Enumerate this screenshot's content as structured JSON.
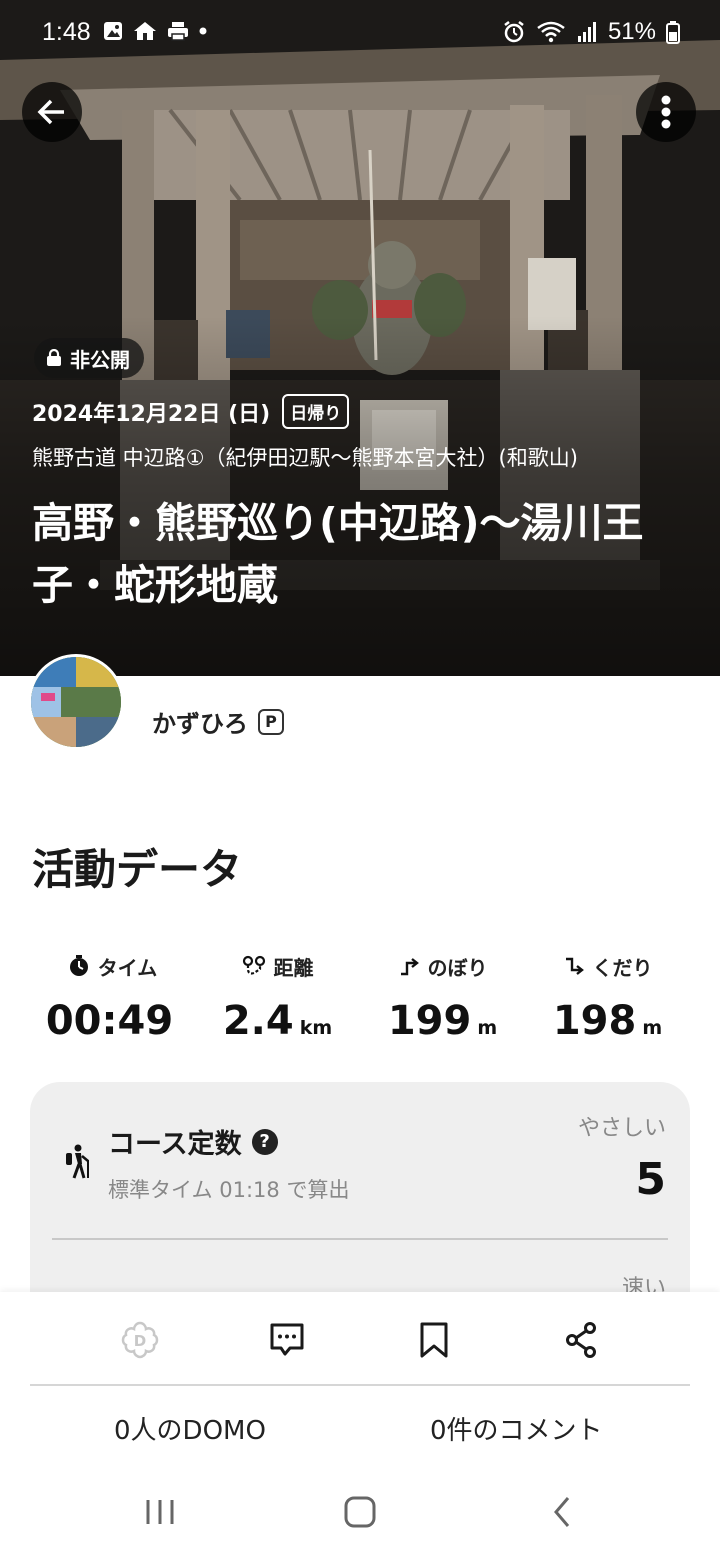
{
  "status_bar": {
    "time": "1:48",
    "battery": "51%"
  },
  "hero": {
    "privacy_label": "非公開",
    "date": "2024年12月22日 (日)",
    "trip_type": "日帰り",
    "route": "熊野古道 中辺路①（紀伊田辺駅〜熊野本宮大社）(和歌山)",
    "title": "高野・熊野巡り(中辺路)〜湯川王子・蛇形地蔵"
  },
  "author": {
    "name": "かずひろ",
    "badge": "P"
  },
  "activity": {
    "section_title": "活動データ",
    "stats": [
      {
        "icon": "stopwatch-icon",
        "label": "タイム",
        "value": "00:49",
        "unit": ""
      },
      {
        "icon": "distance-icon",
        "label": "距離",
        "value": "2.4",
        "unit": "km"
      },
      {
        "icon": "ascent-icon",
        "label": "のぼり",
        "value": "199",
        "unit": "m"
      },
      {
        "icon": "descent-icon",
        "label": "くだり",
        "value": "198",
        "unit": "m"
      }
    ],
    "course": {
      "title": "コース定数",
      "help": "?",
      "subtitle": "標準タイム 01:18 で算出",
      "level": "やさしい",
      "score": "5",
      "pace_label": "速い"
    }
  },
  "actions": {
    "domo_count": "0人のDOMO",
    "comment_count": "0件のコメント"
  },
  "colors": {
    "accent_gray": "#efefef",
    "hero_overlay": "#000000"
  }
}
